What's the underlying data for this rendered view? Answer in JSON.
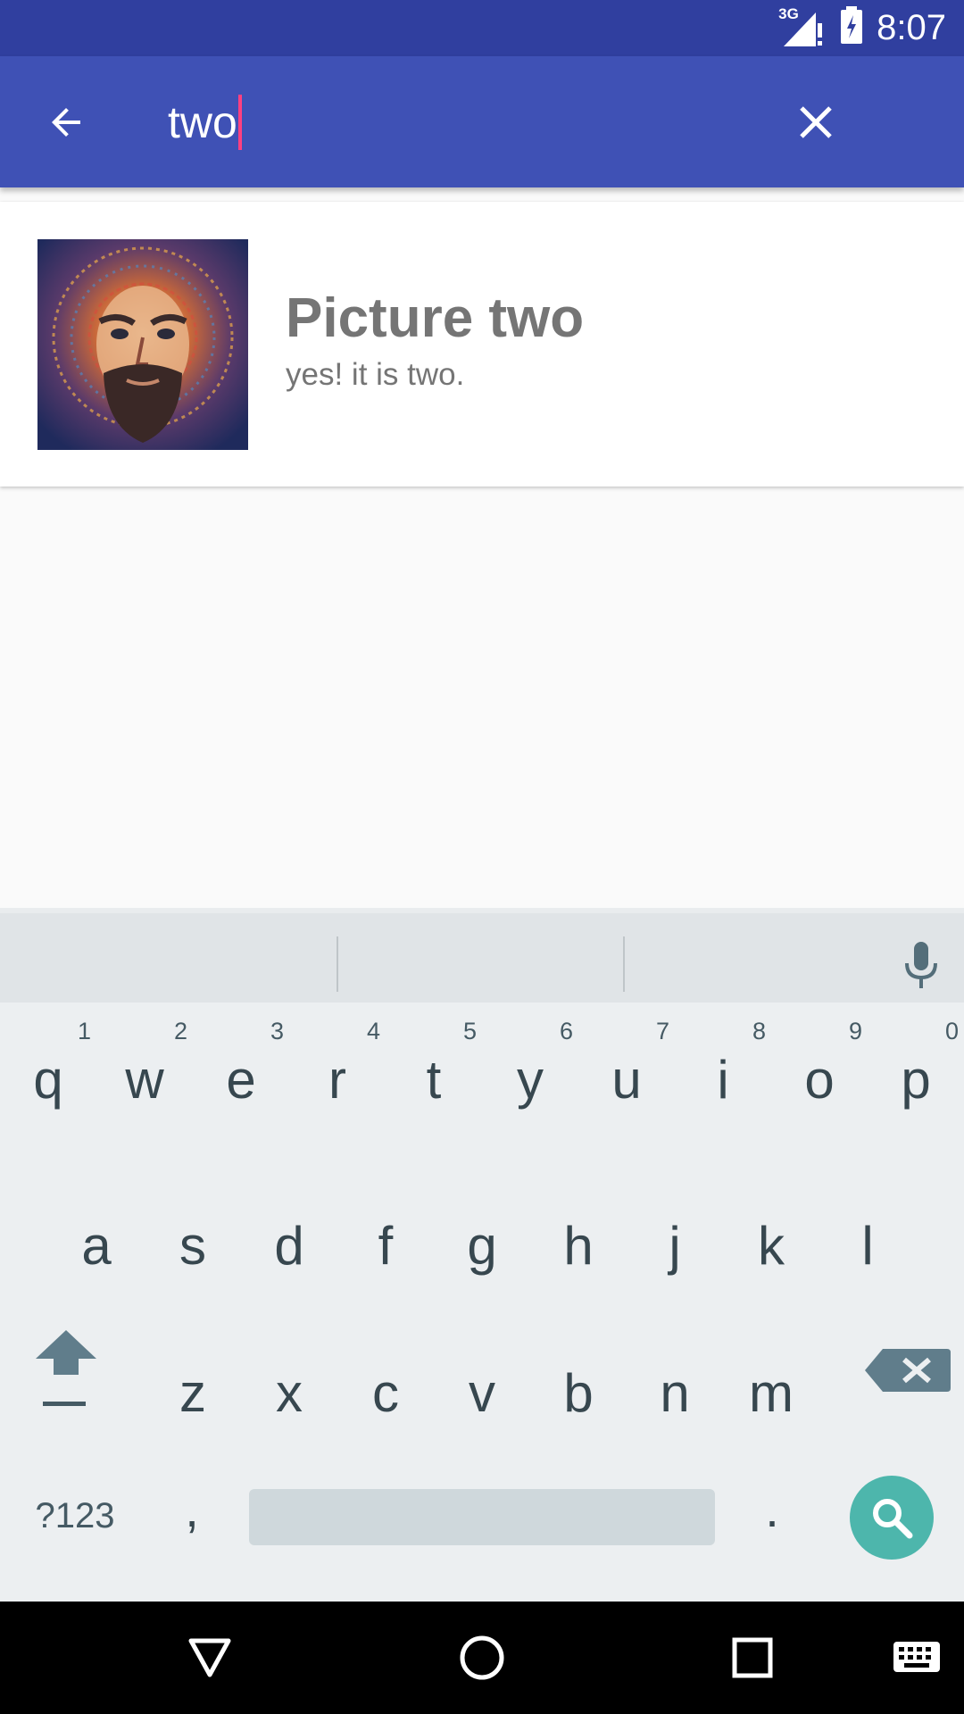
{
  "status_bar": {
    "network": "3G",
    "time": "8:07",
    "bg_color": "#303f9f"
  },
  "toolbar": {
    "bg_color": "#3f51b5",
    "back_icon": "arrow-left-icon",
    "query": "two",
    "clear_icon": "close-icon"
  },
  "results": [
    {
      "title": "Picture two",
      "subtitle": "yes! it is two.",
      "thumbnail": "portrait-painting"
    }
  ],
  "keyboard": {
    "row1": [
      {
        "ch": "q",
        "hint": "1"
      },
      {
        "ch": "w",
        "hint": "2"
      },
      {
        "ch": "e",
        "hint": "3"
      },
      {
        "ch": "r",
        "hint": "4"
      },
      {
        "ch": "t",
        "hint": "5"
      },
      {
        "ch": "y",
        "hint": "6"
      },
      {
        "ch": "u",
        "hint": "7"
      },
      {
        "ch": "i",
        "hint": "8"
      },
      {
        "ch": "o",
        "hint": "9"
      },
      {
        "ch": "p",
        "hint": "0"
      }
    ],
    "row2": [
      "a",
      "s",
      "d",
      "f",
      "g",
      "h",
      "j",
      "k",
      "l"
    ],
    "row3": [
      "z",
      "x",
      "c",
      "v",
      "b",
      "n",
      "m"
    ],
    "symbols_label": "?123",
    "comma": ",",
    "period": ".",
    "accent_color": "#4db6ac"
  },
  "nav": {
    "back_icon": "triangle-back-icon",
    "home_icon": "circle-home-icon",
    "recents_icon": "square-recents-icon",
    "keyboard_icon": "keyboard-icon"
  }
}
